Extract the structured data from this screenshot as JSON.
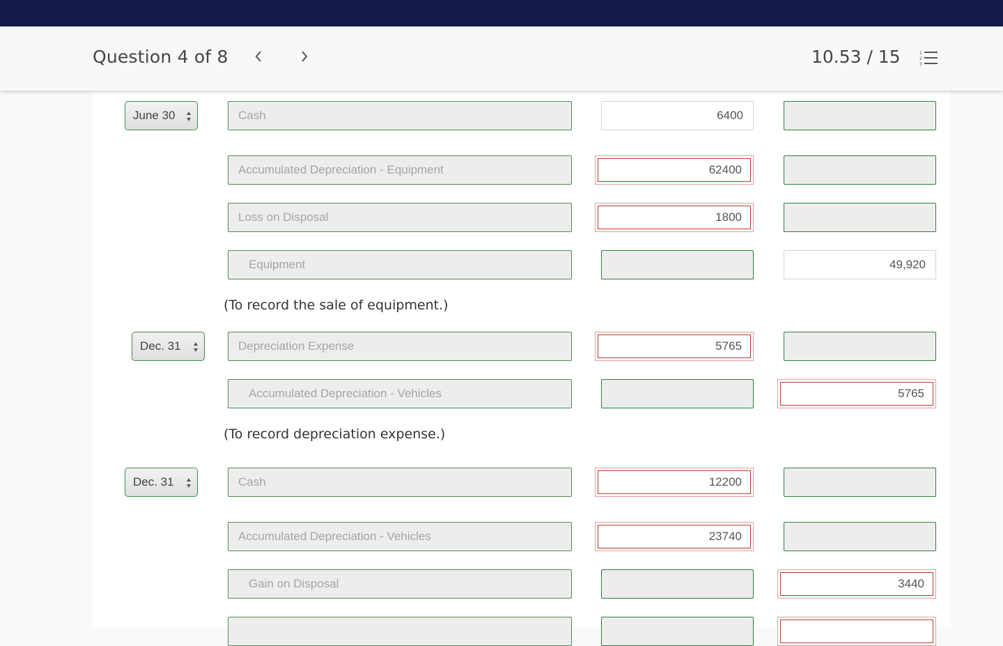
{
  "header": {
    "question_label": "Question 4 of 8",
    "prev_icon": "chevron-left-icon",
    "next_icon": "chevron-right-icon",
    "score": "10.53 / 15",
    "list_icon": "numbered-list-icon"
  },
  "colors": {
    "topbar": "#161c4a",
    "correct_border": "#2e7d3c",
    "incorrect_border": "#c0392b"
  },
  "entries": [
    {
      "date": "June 30",
      "lines": [
        {
          "account": "Cash",
          "debit": "6400",
          "credit": "",
          "debit_status": "neutral",
          "credit_status": "correct"
        },
        {
          "account": "Accumulated Depreciation - Equipment",
          "debit": "62400",
          "credit": "",
          "debit_status": "incorrect",
          "credit_status": "correct"
        },
        {
          "account": "Loss on Disposal",
          "debit": "1800",
          "credit": "",
          "debit_status": "incorrect",
          "credit_status": "correct"
        },
        {
          "account": "Equipment",
          "debit": "",
          "credit": "49,920",
          "debit_status": "correct",
          "credit_status": "neutral"
        }
      ],
      "note": "(To record the sale of equipment.)"
    },
    {
      "date": "Dec. 31",
      "lines": [
        {
          "account": "Depreciation Expense",
          "debit": "5765",
          "credit": "",
          "debit_status": "incorrect",
          "credit_status": "correct"
        },
        {
          "account": "Accumulated Depreciation - Vehicles",
          "debit": "",
          "credit": "5765",
          "debit_status": "correct",
          "credit_status": "incorrect"
        }
      ],
      "note": "(To record depreciation expense.)"
    },
    {
      "date": "Dec. 31",
      "lines": [
        {
          "account": "Cash",
          "debit": "12200",
          "credit": "",
          "debit_status": "incorrect",
          "credit_status": "correct"
        },
        {
          "account": "Accumulated Depreciation - Vehicles",
          "debit": "23740",
          "credit": "",
          "debit_status": "incorrect",
          "credit_status": "correct"
        },
        {
          "account": "Gain on Disposal",
          "debit": "",
          "credit": "3440",
          "debit_status": "correct",
          "credit_status": "incorrect"
        },
        {
          "account": "",
          "debit": "",
          "credit": "",
          "debit_status": "correct",
          "credit_status": "incorrect"
        }
      ]
    }
  ]
}
